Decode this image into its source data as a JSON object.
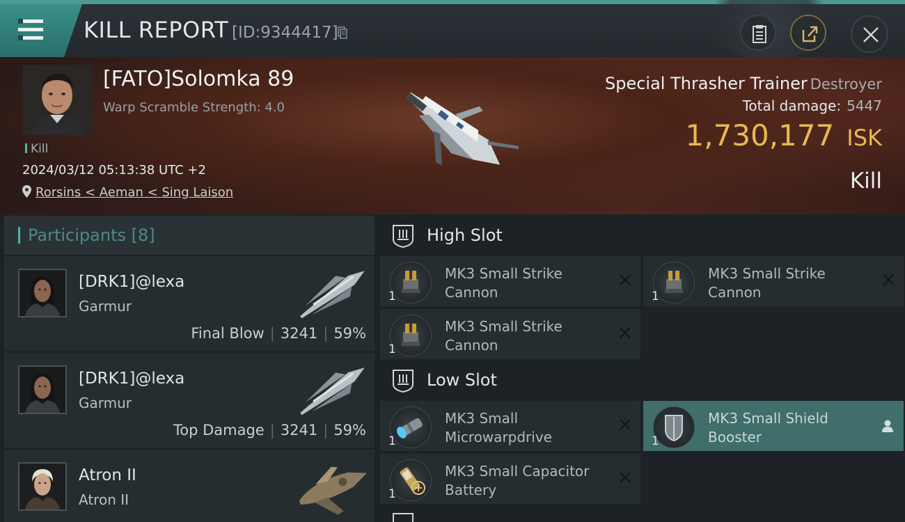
{
  "header": {
    "title": "KILL REPORT",
    "report_id": "[ID:9344417]"
  },
  "victim": {
    "name": "[FATO]Solomka 89",
    "warp": "Warp Scramble Strength: 4.0",
    "kill_tag": "Kill",
    "datetime": "2024/03/12 05:13:38 UTC +2",
    "location": "Rorsins < Aeman < Sing Laison",
    "ship_name": "Special Thrasher Trainer",
    "ship_class": "Destroyer",
    "total_damage_label": "Total damage:",
    "total_damage": "5447",
    "isk_value": "1,730,177",
    "isk_unit": "ISK",
    "result": "Kill"
  },
  "participants": {
    "title": "Participants [8]",
    "rows": [
      {
        "name": "[DRK1]@lexa",
        "ship": "Garmur",
        "role": "Final Blow",
        "damage": "3241",
        "percent": "59%"
      },
      {
        "name": "[DRK1]@lexa",
        "ship": "Garmur",
        "role": "Top Damage",
        "damage": "3241",
        "percent": "59%"
      },
      {
        "name": "Atron II",
        "ship": "Atron II",
        "role": "",
        "damage": "",
        "percent": ""
      }
    ]
  },
  "fitting": {
    "high_slot": {
      "label": "High Slot",
      "modules": [
        {
          "name": "MK3 Small Strike Cannon",
          "qty": "1"
        },
        {
          "name": "MK3 Small Strike Cannon",
          "qty": "1"
        },
        {
          "name": "MK3 Small Strike Cannon",
          "qty": "1"
        }
      ]
    },
    "low_slot": {
      "label": "Low Slot",
      "modules": [
        {
          "name": "MK3 Small Microwarpdrive",
          "qty": "1"
        },
        {
          "name": "MK3 Small Shield Booster",
          "qty": "1"
        },
        {
          "name": "MK3 Small Capacitor Battery",
          "qty": "1"
        }
      ]
    }
  },
  "colors": {
    "accent": "#4fb3a8",
    "isk": "#e8b852",
    "active_module": "#3f6e6b"
  }
}
